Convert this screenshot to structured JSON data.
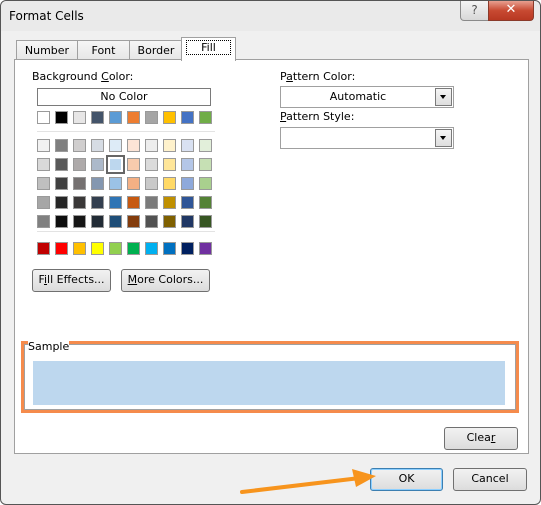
{
  "window": {
    "title": "Format Cells",
    "help_glyph": "?",
    "close_glyph": "✕"
  },
  "tabs": [
    {
      "label": "Number"
    },
    {
      "label": "Font"
    },
    {
      "label": "Border"
    },
    {
      "label": "Fill",
      "active": true
    }
  ],
  "background_color": {
    "label_pre": "Background ",
    "label_accel": "C",
    "label_post": "olor:",
    "no_color": "No Color",
    "theme_row": [
      "#ffffff",
      "#000000",
      "#e7e6e6",
      "#44546a",
      "#5b9bd5",
      "#ed7d31",
      "#a5a5a5",
      "#ffc000",
      "#4472c4",
      "#70ad47"
    ],
    "tint_rows": [
      [
        "#f2f2f2",
        "#7f7f7f",
        "#d0cece",
        "#d6dce4",
        "#ddebf7",
        "#fce4d6",
        "#ededed",
        "#fff2cc",
        "#d9e1f2",
        "#e2efda"
      ],
      [
        "#d9d9d9",
        "#595959",
        "#aeaaaa",
        "#acb9ca",
        "#bdd7ee",
        "#f8cbad",
        "#dbdbdb",
        "#ffe699",
        "#b4c6e7",
        "#c6e0b4"
      ],
      [
        "#bfbfbf",
        "#404040",
        "#757171",
        "#8497b0",
        "#9bc2e6",
        "#f4b084",
        "#c9c9c9",
        "#ffd966",
        "#8ea9db",
        "#a9d08e"
      ],
      [
        "#a6a6a6",
        "#262626",
        "#3a3838",
        "#333f4f",
        "#2f75b5",
        "#c65911",
        "#7b7b7b",
        "#bf8f00",
        "#2f5597",
        "#548235"
      ],
      [
        "#808080",
        "#0d0d0d",
        "#161616",
        "#222b35",
        "#1f4e78",
        "#833c0c",
        "#525252",
        "#7f6000",
        "#203764",
        "#375623"
      ]
    ],
    "selected": {
      "row": 1,
      "col": 4
    },
    "standard_row": [
      "#c00000",
      "#ff0000",
      "#ffc000",
      "#ffff00",
      "#92d050",
      "#00b050",
      "#00b0f0",
      "#0070c0",
      "#002060",
      "#7030a0"
    ]
  },
  "buttons": {
    "fill_effects": {
      "pre": "F",
      "accel": "i",
      "post": "ll Effects..."
    },
    "more_colors": {
      "pre": "",
      "accel": "M",
      "post": "ore Colors..."
    },
    "clear": {
      "pre": "Clea",
      "accel": "r",
      "post": ""
    },
    "ok": "OK",
    "cancel": "Cancel"
  },
  "pattern_color": {
    "label_pre": "P",
    "label_accel": "a",
    "label_post": "ttern Color:",
    "value": "Automatic"
  },
  "pattern_style": {
    "label_pre": "",
    "label_accel": "P",
    "label_post": "attern Style:",
    "value": ""
  },
  "sample": {
    "label": "Sample",
    "color": "#bdd7ee"
  },
  "annotation": {
    "highlight_color": "#f58b4c",
    "arrow_color": "#f7941d"
  }
}
